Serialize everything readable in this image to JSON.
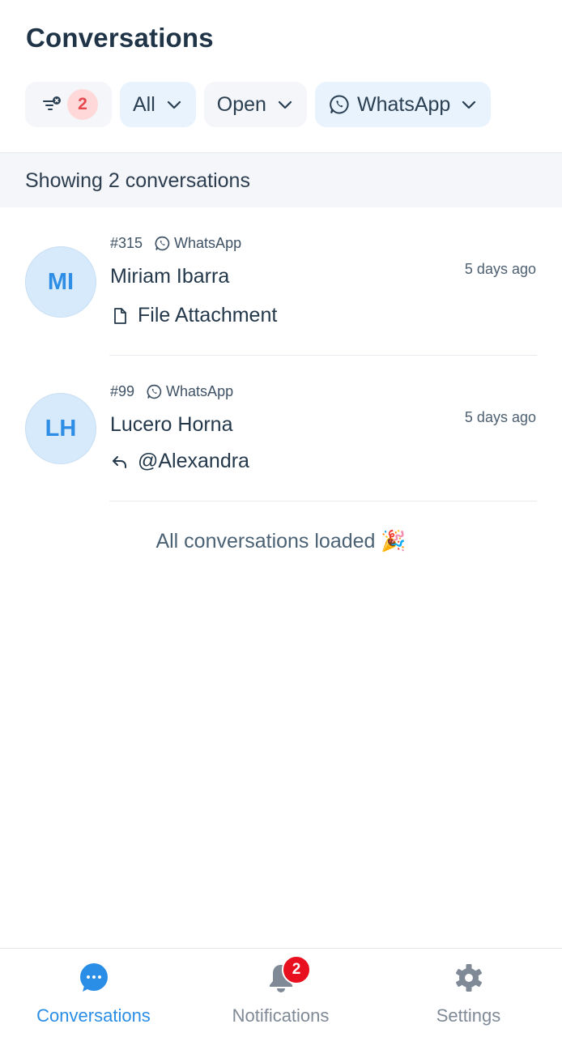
{
  "header": {
    "title": "Conversations"
  },
  "filters": {
    "clear": {
      "icon": "filter-clear-icon",
      "count": "2"
    },
    "assignee": {
      "label": "All"
    },
    "status": {
      "label": "Open"
    },
    "inbox": {
      "label": "WhatsApp",
      "icon": "whatsapp-icon"
    }
  },
  "summary": {
    "text": "Showing 2 conversations"
  },
  "conversations": [
    {
      "initials": "MI",
      "id": "#315",
      "inbox": "WhatsApp",
      "name": "Miriam Ibarra",
      "time": "5 days ago",
      "preview": "File Attachment",
      "preview_icon": "file-icon"
    },
    {
      "initials": "LH",
      "id": "#99",
      "inbox": "WhatsApp",
      "name": "Lucero Horna",
      "time": "5 days ago",
      "preview": "@Alexandra",
      "preview_icon": "reply-icon"
    }
  ],
  "footer_note": {
    "text": "All conversations loaded 🎉"
  },
  "tabs": [
    {
      "label": "Conversations",
      "icon": "chat-bubble-icon",
      "active": true
    },
    {
      "label": "Notifications",
      "icon": "bell-icon",
      "badge": "2"
    },
    {
      "label": "Settings",
      "icon": "gear-icon"
    }
  ],
  "colors": {
    "accent": "#2a8ee6",
    "badge_red": "#e8101e",
    "muted": "#7f8a96"
  }
}
